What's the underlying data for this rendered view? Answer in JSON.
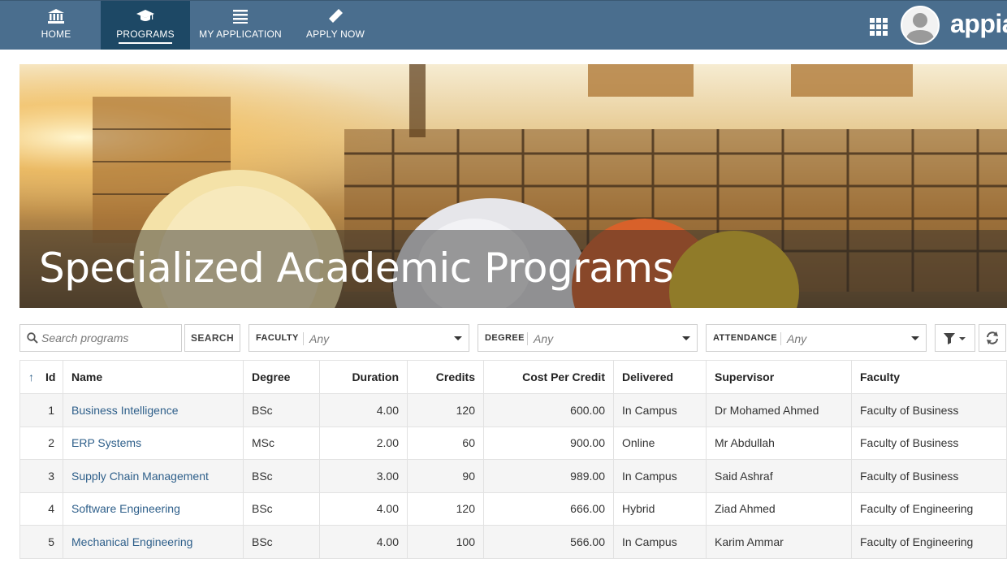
{
  "nav": {
    "items": [
      {
        "label": "HOME",
        "icon": "bank-icon"
      },
      {
        "label": "PROGRAMS",
        "icon": "graduation-cap-icon",
        "active": true
      },
      {
        "label": "MY APPLICATION",
        "icon": "list-icon"
      },
      {
        "label": "APPLY NOW",
        "icon": "pencil-icon"
      }
    ],
    "apps_icon": "apps-grid-icon",
    "avatar_icon": "user-avatar-icon",
    "brand": "appian"
  },
  "banner": {
    "title": "Specialized Academic Programs"
  },
  "filters": {
    "search_placeholder": "Search programs",
    "search_button": "SEARCH",
    "faculty": {
      "label": "FACULTY",
      "value": "Any"
    },
    "degree": {
      "label": "DEGREE",
      "value": "Any"
    },
    "attendance": {
      "label": "ATTENDANCE",
      "value": "Any"
    },
    "filter_icon": "filter-icon",
    "refresh_icon": "refresh-icon"
  },
  "table": {
    "sort_indicator": "↑",
    "columns": [
      "Id",
      "Name",
      "Degree",
      "Duration",
      "Credits",
      "Cost Per Credit",
      "Delivered",
      "Supervisor",
      "Faculty"
    ],
    "rows": [
      {
        "id": "1",
        "name": "Business Intelligence",
        "degree": "BSc",
        "duration": "4.00",
        "credits": "120",
        "cost": "600.00",
        "delivered": "In Campus",
        "supervisor": "Dr Mohamed Ahmed",
        "faculty": "Faculty of Business"
      },
      {
        "id": "2",
        "name": "ERP Systems",
        "degree": "MSc",
        "duration": "2.00",
        "credits": "60",
        "cost": "900.00",
        "delivered": "Online",
        "supervisor": "Mr Abdullah",
        "faculty": "Faculty of Business"
      },
      {
        "id": "3",
        "name": "Supply Chain Management",
        "degree": "BSc",
        "duration": "3.00",
        "credits": "90",
        "cost": "989.00",
        "delivered": "In Campus",
        "supervisor": "Said Ashraf",
        "faculty": "Faculty of Business"
      },
      {
        "id": "4",
        "name": "Software Engineering",
        "degree": "BSc",
        "duration": "4.00",
        "credits": "120",
        "cost": "666.00",
        "delivered": "Hybrid",
        "supervisor": "Ziad Ahmed",
        "faculty": "Faculty of Engineering"
      },
      {
        "id": "5",
        "name": "Mechanical Engineering",
        "degree": "BSc",
        "duration": "4.00",
        "credits": "100",
        "cost": "566.00",
        "delivered": "In Campus",
        "supervisor": "Karim Ammar",
        "faculty": "Faculty of Engineering"
      }
    ]
  },
  "colors": {
    "nav_bg": "#4a6e8e",
    "nav_active": "#1d4865",
    "link": "#2e5f8a"
  }
}
